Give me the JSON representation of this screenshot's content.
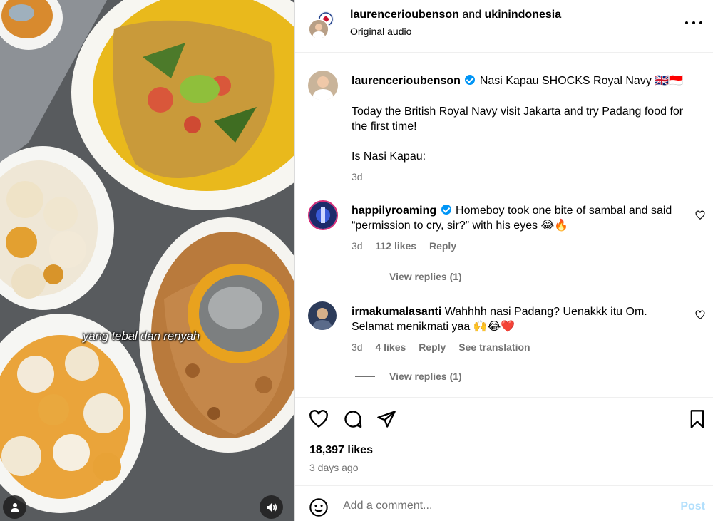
{
  "media": {
    "caption_overlay": "yang tebal dan renyah",
    "user_icon": "user-icon",
    "sound_icon": "speaker-icon"
  },
  "header": {
    "user1": "laurencerioubenson",
    "joiner": "and",
    "user2": "ukinindonesia",
    "audio": "Original audio"
  },
  "post": {
    "username": "laurencerioubenson",
    "title": "Nasi Kapau SHOCKS Royal Navy 🇬🇧🇮🇩",
    "text1": "Today the British Royal Navy visit Jakarta and try Padang food for the first time!",
    "text2": "Is Nasi Kapau:",
    "time": "3d"
  },
  "comments": [
    {
      "username": "happilyroaming",
      "verified": true,
      "text": "Homeboy took one bite of sambal and said “permission to cry, sir?” with his eyes 😂🔥",
      "time": "3d",
      "likes": "112 likes",
      "reply": "Reply",
      "view_replies": "View replies (1)"
    },
    {
      "username": "irmakumalasanti",
      "verified": false,
      "text": "Wahhhh nasi Padang? Uenakkk itu Om. Selamat menikmati yaa 🙌😂❤️",
      "time": "3d",
      "likes": "4 likes",
      "reply": "Reply",
      "translate": "See translation",
      "view_replies": "View replies (1)"
    }
  ],
  "actions": {
    "likes": "18,397 likes",
    "ago": "3 days ago"
  },
  "composer": {
    "placeholder": "Add a comment...",
    "post": "Post"
  },
  "colors": {
    "verified": "#0095f6",
    "secondary_text": "#737373",
    "post_disabled": "#b2dffc"
  }
}
